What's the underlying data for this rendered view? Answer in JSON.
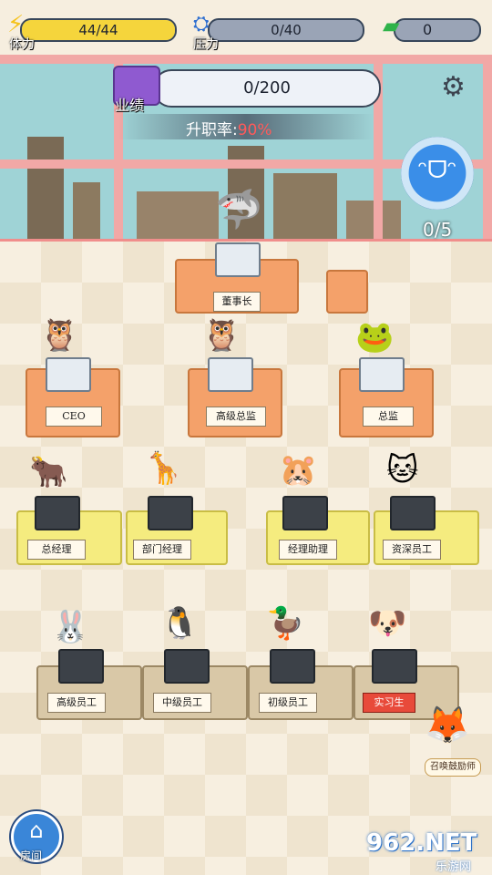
{
  "hud": {
    "stamina": {
      "label": "体力",
      "value": "44/44",
      "fill_fraction": 1.0,
      "icon": "lightning-icon"
    },
    "pressure": {
      "label": "压力",
      "value": "0/40",
      "fill_fraction": 0.0,
      "icon": "pressure-gauge-icon"
    },
    "money": {
      "value": "0",
      "icon": "cash-icon"
    }
  },
  "performance": {
    "label": "业绩",
    "value": "0/200",
    "icon": "folder-icon"
  },
  "promotion": {
    "label": "升职率:",
    "value": "90%"
  },
  "settings": {
    "icon": "gear-icon"
  },
  "summon": {
    "count": "0/5",
    "icon": "laughing-face-icon"
  },
  "desks": {
    "chairman": "董事长",
    "ceo": "CEO",
    "senior_director": "高级总监",
    "director": "总监",
    "general_manager": "总经理",
    "dept_manager": "部门经理",
    "asst_manager": "经理助理",
    "senior_staff": "资深员工",
    "high_staff": "高级员工",
    "mid_staff": "中级员工",
    "junior_staff": "初级员工",
    "intern": "实习生"
  },
  "buttons": {
    "room": {
      "label": "房间",
      "icon": "house-icon"
    },
    "cheerleader": {
      "label": "召唤鼓励师",
      "icon": "cheerleader-fox-icon"
    }
  },
  "watermark": {
    "main": "962.NET",
    "sub": "乐游网"
  },
  "colors": {
    "accent_red": "#ff5a5a",
    "stamina_fill": "#f5d53c",
    "intern_plate": "#e84a3a"
  }
}
